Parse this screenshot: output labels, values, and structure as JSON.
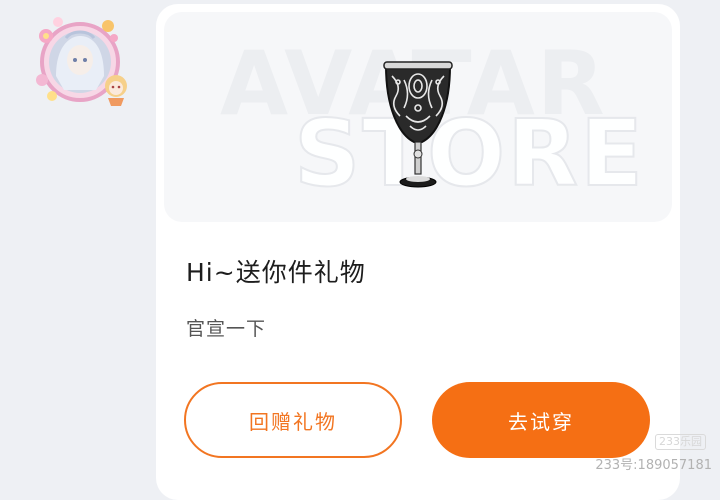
{
  "banner": {
    "watermark_line1": "AVATAR",
    "watermark_line2": "STORE",
    "item_icon": "goblet-icon"
  },
  "gift": {
    "title": "Hi~送你件礼物",
    "subtitle": "官宣一下"
  },
  "actions": {
    "return_gift_label": "回赠礼物",
    "try_on_label": "去试穿"
  },
  "watermark": {
    "logo": "233乐园",
    "user_id": "233号:189057181"
  },
  "colors": {
    "accent": "#f56f14",
    "accent_border": "#f27521",
    "page_background": "#eef0f4",
    "card_background": "#ffffff"
  }
}
